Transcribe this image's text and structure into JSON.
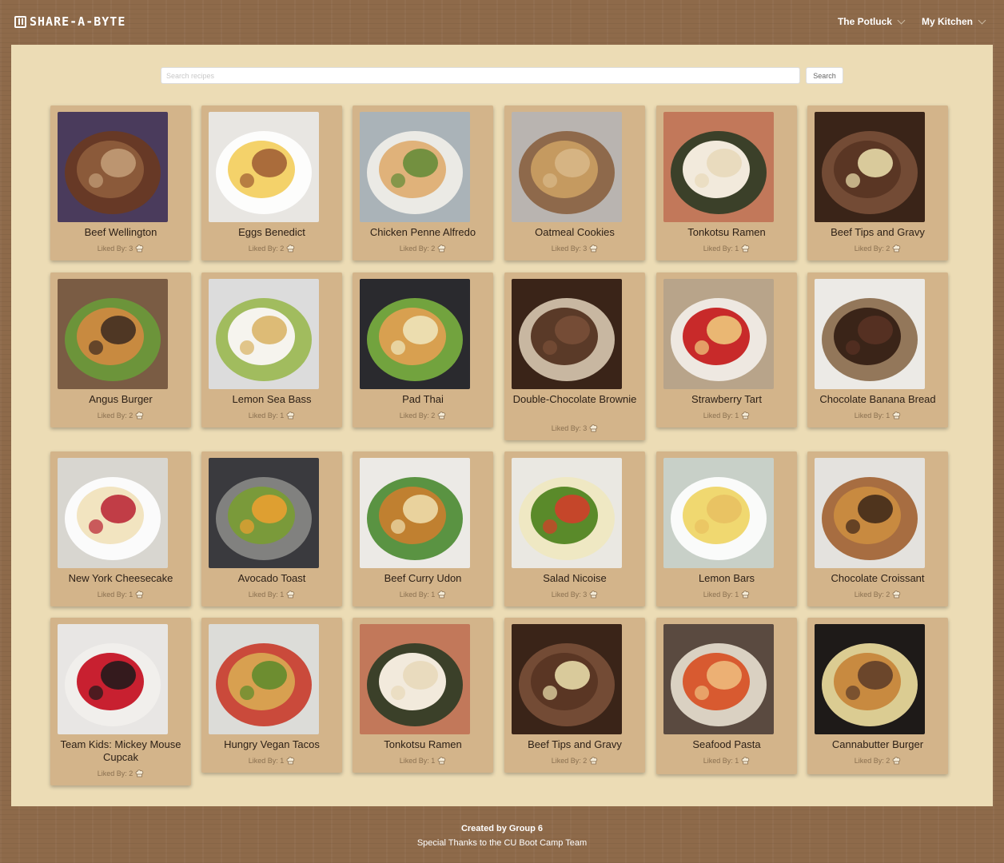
{
  "header": {
    "brand": "SHARE-A-BYTE",
    "nav": [
      {
        "label": "The Potluck"
      },
      {
        "label": "My Kitchen"
      }
    ]
  },
  "search": {
    "placeholder": "Search recipes",
    "value": "",
    "button_label": "Search"
  },
  "likes_prefix": "Liked By: ",
  "recipes": [
    {
      "name": "Beef Wellington",
      "likes": 3,
      "colors": [
        "#4a3b5c",
        "#8b5a3a",
        "#c4a07a",
        "#6a3a20"
      ]
    },
    {
      "name": "Eggs Benedict",
      "likes": 2,
      "colors": [
        "#e8e6e2",
        "#f4d26a",
        "#9c5a32",
        "#ffffff"
      ]
    },
    {
      "name": "Chicken Penne Alfredo",
      "likes": 2,
      "colors": [
        "#aab3b8",
        "#e0b27a",
        "#5f8a36",
        "#f2f0ea"
      ]
    },
    {
      "name": "Oatmeal Cookies",
      "likes": 3,
      "colors": [
        "#b9b4b0",
        "#c59a60",
        "#d8b98a",
        "#8a6040"
      ]
    },
    {
      "name": "Tonkotsu Ramen",
      "likes": 1,
      "colors": [
        "#c2785a",
        "#f2eadc",
        "#e8d8b8",
        "#2c3a24"
      ]
    },
    {
      "name": "Beef Tips and Gravy",
      "likes": 2,
      "colors": [
        "#3a2418",
        "#5a3624",
        "#f0e4b0",
        "#7a5038"
      ]
    },
    {
      "name": "Angus Burger",
      "likes": 2,
      "colors": [
        "#7a5c44",
        "#c88a40",
        "#3a2820",
        "#6a9a3a"
      ]
    },
    {
      "name": "Lemon Sea Bass",
      "likes": 1,
      "colors": [
        "#dcdcdc",
        "#f6f4ee",
        "#d8b060",
        "#9ab850"
      ]
    },
    {
      "name": "Pad Thai",
      "likes": 2,
      "colors": [
        "#2a2a2e",
        "#d8a050",
        "#f0e8c0",
        "#7ab040"
      ]
    },
    {
      "name": "Double-Chocolate Brownie",
      "likes": 3,
      "colors": [
        "#3a2418",
        "#5a3a28",
        "#7a5038",
        "#d8c8b0"
      ]
    },
    {
      "name": "Strawberry Tart",
      "likes": 1,
      "colors": [
        "#b8a48a",
        "#c82a2a",
        "#f0d080",
        "#f4f0ea"
      ]
    },
    {
      "name": "Chocolate Banana Bread",
      "likes": 1,
      "colors": [
        "#eceae6",
        "#3a2418",
        "#5a3224",
        "#8a6a4a"
      ]
    },
    {
      "name": "New York Cheesecake",
      "likes": 1,
      "colors": [
        "#d8d6d0",
        "#f2e4c0",
        "#b82030",
        "#ffffff"
      ]
    },
    {
      "name": "Avocado Toast",
      "likes": 1,
      "colors": [
        "#3a3a3e",
        "#7a9a3a",
        "#f0a030",
        "#8a8a86"
      ]
    },
    {
      "name": "Beef Curry Udon",
      "likes": 1,
      "colors": [
        "#eceae6",
        "#c08030",
        "#f0e0b0",
        "#4a8a30"
      ]
    },
    {
      "name": "Salad Nicoise",
      "likes": 3,
      "colors": [
        "#eae8e2",
        "#5a8a2a",
        "#d83a2a",
        "#f0e8c0"
      ]
    },
    {
      "name": "Lemon Bars",
      "likes": 1,
      "colors": [
        "#c8d0c8",
        "#f0d870",
        "#e8c060",
        "#ffffff"
      ]
    },
    {
      "name": "Chocolate Croissant",
      "likes": 2,
      "colors": [
        "#e4e2de",
        "#c88a40",
        "#3a2418",
        "#a06030"
      ]
    },
    {
      "name": "Team Kids: Mickey Mouse Cupcak",
      "likes": 2,
      "colors": [
        "#e8e6e4",
        "#c82030",
        "#1a1a1a",
        "#f2f0ec"
      ]
    },
    {
      "name": "Hungry Vegan Tacos",
      "likes": 1,
      "colors": [
        "#dcdcd8",
        "#d8a050",
        "#5a8a2a",
        "#c83a2a"
      ]
    },
    {
      "name": "Tonkotsu Ramen",
      "likes": 1,
      "colors": [
        "#c2785a",
        "#f2eadc",
        "#e8d8b8",
        "#2c3a24"
      ]
    },
    {
      "name": "Beef Tips and Gravy",
      "likes": 2,
      "colors": [
        "#3a2418",
        "#5a3624",
        "#f0e4b0",
        "#7a5038"
      ]
    },
    {
      "name": "Seafood Pasta",
      "likes": 1,
      "colors": [
        "#5a4a40",
        "#d85a30",
        "#f0c080",
        "#e8e0d0"
      ]
    },
    {
      "name": "Cannabutter Burger",
      "likes": 2,
      "colors": [
        "#1e1a18",
        "#c88a40",
        "#5a3a28",
        "#f0e0a0"
      ]
    }
  ],
  "footer": {
    "credit": "Created by Group 6",
    "thanks": "Special Thanks to the CU Boot Camp Team"
  }
}
